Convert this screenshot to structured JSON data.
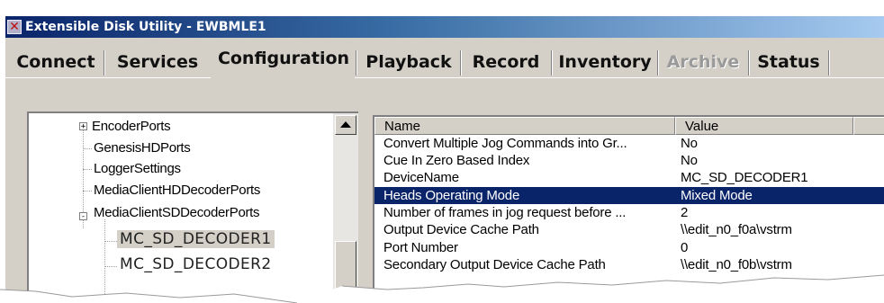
{
  "window": {
    "title": "Extensible Disk Utility - EWBMLE1",
    "icon": "app-x-icon"
  },
  "tabs": [
    {
      "label": "Connect",
      "state": "normal"
    },
    {
      "label": "Services",
      "state": "normal"
    },
    {
      "label": "Configuration",
      "state": "selected"
    },
    {
      "label": "Playback",
      "state": "normal"
    },
    {
      "label": "Record",
      "state": "normal"
    },
    {
      "label": "Inventory",
      "state": "normal"
    },
    {
      "label": "Archive",
      "state": "disabled"
    },
    {
      "label": "Status",
      "state": "normal"
    }
  ],
  "tree": {
    "items": [
      {
        "label": "EncoderPorts",
        "expander": "+"
      },
      {
        "label": "GenesisHDPorts"
      },
      {
        "label": "LoggerSettings"
      },
      {
        "label": "MediaClientHDDecoderPorts"
      },
      {
        "label": "MediaClientSDDecoderPorts",
        "expander": "-"
      },
      {
        "label": "MC_SD_DECODER1",
        "selected": true
      },
      {
        "label": "MC_SD_DECODER2"
      }
    ]
  },
  "properties": {
    "headers": {
      "name": "Name",
      "value": "Value"
    },
    "rows": [
      {
        "name": "Convert Multiple Jog Commands into Gr...",
        "value": "No"
      },
      {
        "name": "Cue In Zero Based Index",
        "value": "No"
      },
      {
        "name": "DeviceName",
        "value": "MC_SD_DECODER1"
      },
      {
        "name": "Heads Operating Mode",
        "value": "Mixed Mode",
        "selected": true
      },
      {
        "name": "Number of frames in jog request before ...",
        "value": "2"
      },
      {
        "name": "Output Device Cache Path",
        "value": "\\\\edit_n0_f0a\\vstrm"
      },
      {
        "name": "Port Number",
        "value": "0"
      },
      {
        "name": "Secondary Output Device Cache Path",
        "value": "\\\\edit_n0_f0b\\vstrm"
      }
    ]
  },
  "colors": {
    "titlebar_start": "#0a246a",
    "titlebar_end": "#a6caf0",
    "dialog_bg": "#d4d0c8",
    "selection": "#0a246a"
  }
}
